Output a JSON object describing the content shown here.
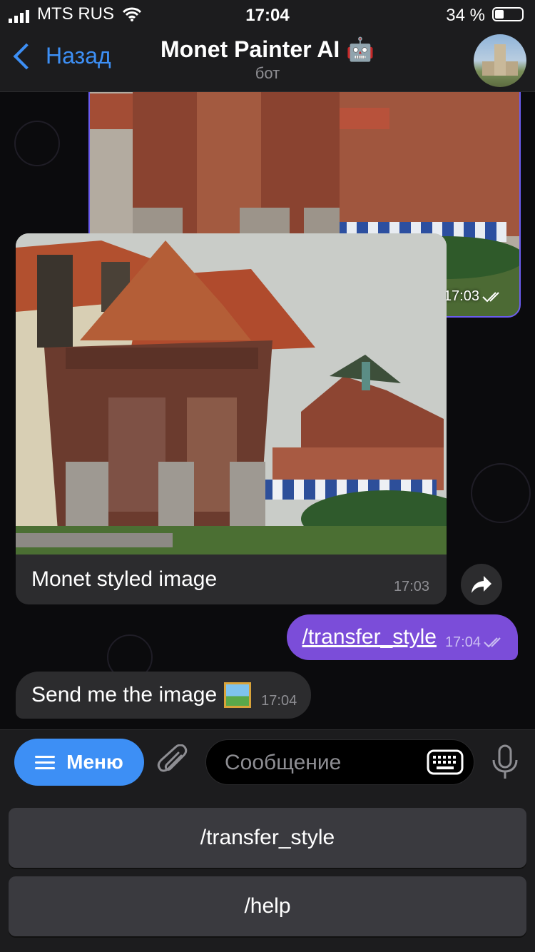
{
  "status_bar": {
    "carrier": "MTS RUS",
    "time": "17:04",
    "battery_percent": "34 %",
    "battery_level": 0.34
  },
  "header": {
    "back_label": "Назад",
    "title": "Monet Painter AI 🤖",
    "subtitle": "бот"
  },
  "messages": {
    "sent_image": {
      "time": "17:03"
    },
    "received_image": {
      "caption": "Monet styled image",
      "time": "17:03"
    },
    "sent_command": {
      "text": "/transfer_style",
      "time": "17:04"
    },
    "received_text": {
      "text": "Send me the image",
      "emoji_icon": "framed-picture-icon",
      "time": "17:04"
    }
  },
  "input_bar": {
    "menu_label": "Меню",
    "placeholder": "Сообщение"
  },
  "bot_keyboard": {
    "buttons": [
      "/transfer_style",
      "/help"
    ]
  },
  "colors": {
    "accent_blue": "#3d8ff5",
    "outgoing_bubble": "#7b4dd9",
    "incoming_bubble": "#2c2c2e",
    "outgoing_border": "#6b5cf0"
  }
}
